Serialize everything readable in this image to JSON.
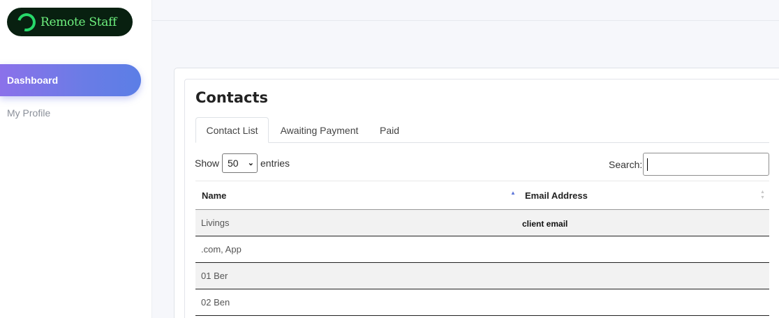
{
  "brand": {
    "name": "Remote Staff"
  },
  "sidebar": {
    "items": [
      {
        "label": "Dashboard",
        "active": true
      },
      {
        "label": "My Profile",
        "active": false
      }
    ]
  },
  "page": {
    "title": "Contacts"
  },
  "tabs": [
    {
      "label": "Contact List",
      "active": true
    },
    {
      "label": "Awaiting Payment",
      "active": false
    },
    {
      "label": "Paid",
      "active": false
    }
  ],
  "length_control": {
    "prefix": "Show",
    "value": "50",
    "suffix": "entries"
  },
  "search": {
    "label": "Search:",
    "value": ""
  },
  "table": {
    "columns": [
      "Name",
      "Email Address"
    ],
    "rows": [
      {
        "name": "Livings",
        "email": "client email"
      },
      {
        "name": ".com, App",
        "email": ""
      },
      {
        "name": "01 Ber",
        "email": ""
      },
      {
        "name": "02 Ben",
        "email": ""
      }
    ]
  },
  "colors": {
    "accent_gradient_start": "#8b71ea",
    "accent_gradient_end": "#5b7ee6",
    "logo_bg": "#082010",
    "logo_text": "#6ef07e"
  },
  "icons": {
    "logo": "remote-staff-ring-icon",
    "select_chevron": "chevron-down-icon",
    "sort_name": "sort-ascending-icon",
    "sort_email": "sort-both-icon"
  }
}
